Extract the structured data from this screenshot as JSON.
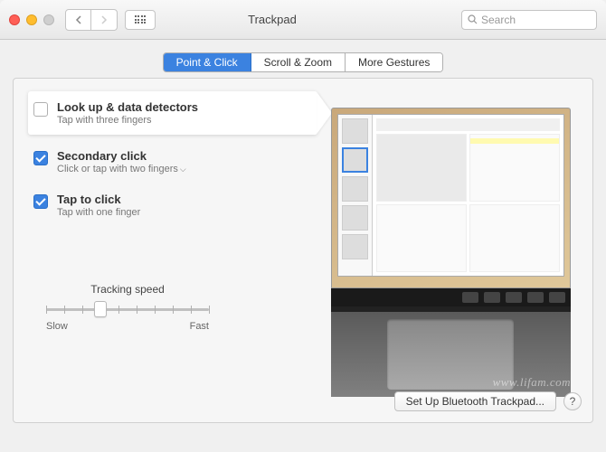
{
  "window": {
    "title": "Trackpad",
    "search_placeholder": "Search"
  },
  "tabs": [
    {
      "label": "Point & Click",
      "active": true
    },
    {
      "label": "Scroll & Zoom",
      "active": false
    },
    {
      "label": "More Gestures",
      "active": false
    }
  ],
  "options": [
    {
      "title": "Look up & data detectors",
      "subtitle": "Tap with three fingers",
      "checked": false,
      "highlighted": true,
      "has_dropdown": false
    },
    {
      "title": "Secondary click",
      "subtitle": "Click or tap with two fingers",
      "checked": true,
      "highlighted": false,
      "has_dropdown": true
    },
    {
      "title": "Tap to click",
      "subtitle": "Tap with one finger",
      "checked": true,
      "highlighted": false,
      "has_dropdown": false
    }
  ],
  "tracking": {
    "label": "Tracking speed",
    "min_label": "Slow",
    "max_label": "Fast",
    "value": 3,
    "ticks": 10
  },
  "footer": {
    "setup_button": "Set Up Bluetooth Trackpad...",
    "help": "?"
  },
  "watermark": "www.lifam.com"
}
